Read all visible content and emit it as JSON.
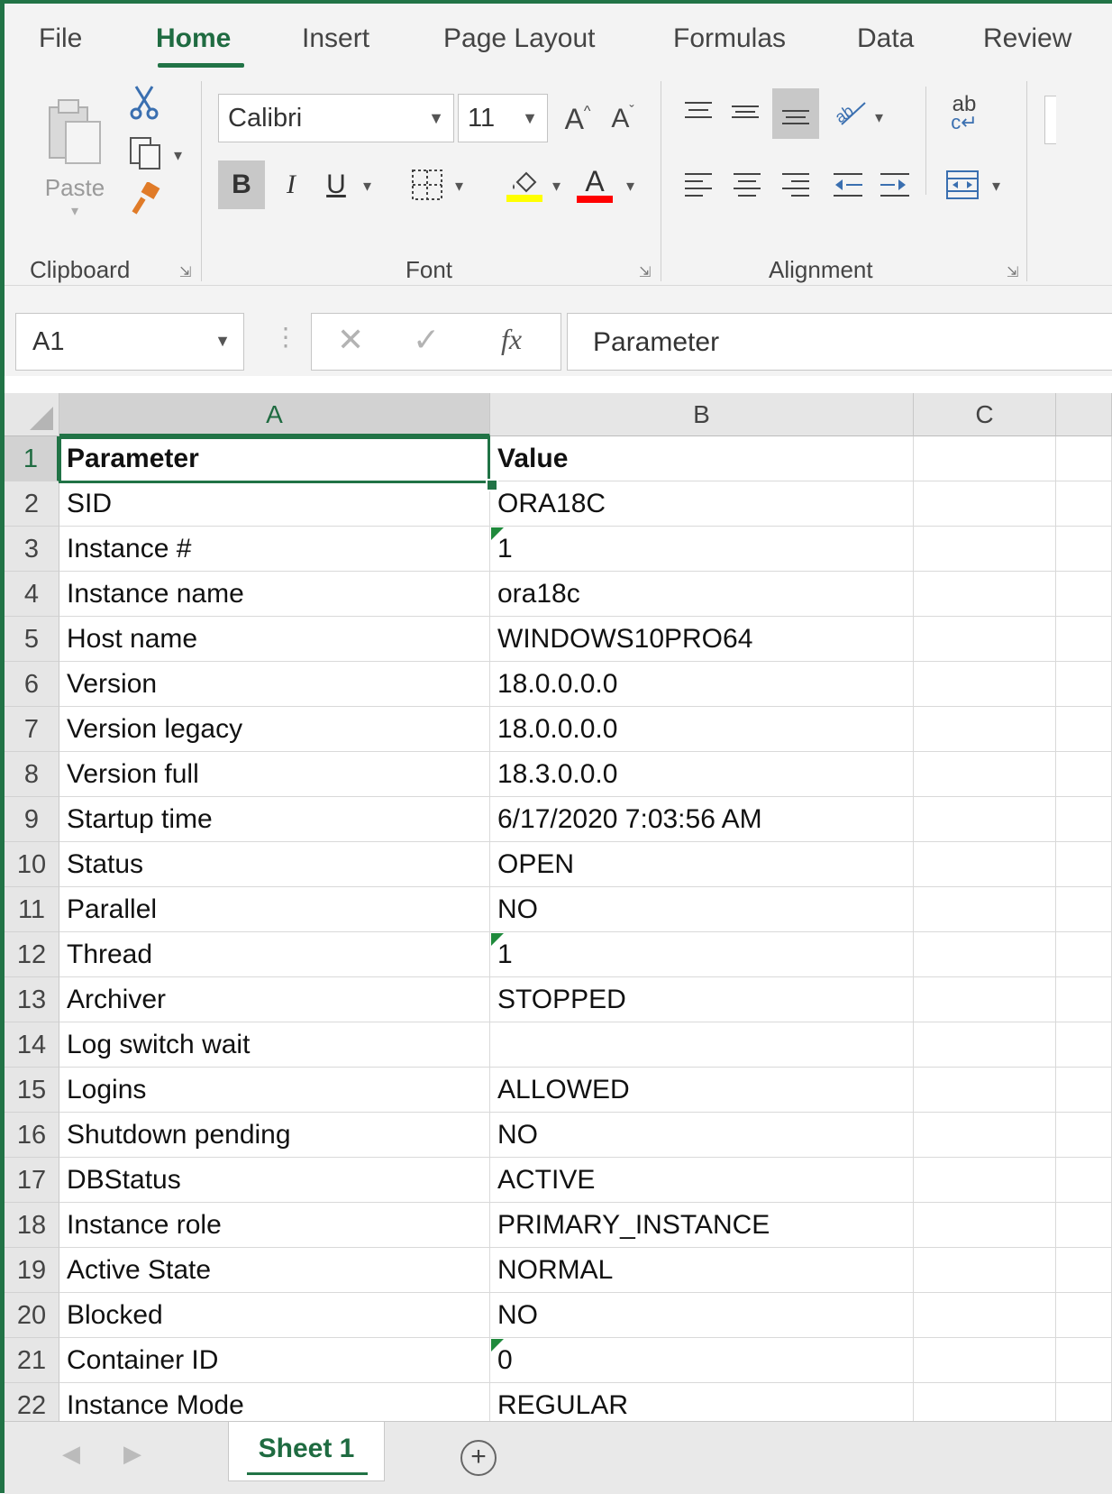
{
  "ribbon_tabs": [
    "File",
    "Home",
    "Insert",
    "Page Layout",
    "Formulas",
    "Data",
    "Review"
  ],
  "active_tab": "Home",
  "clipboard": {
    "paste_label": "Paste",
    "group_label": "Clipboard"
  },
  "font": {
    "family": "Calibri",
    "size": "11",
    "group_label": "Font",
    "grow_label": "A",
    "shrink_label": "A",
    "bold": "B",
    "italic": "I",
    "underline": "U",
    "font_color_label": "A"
  },
  "alignment": {
    "group_label": "Alignment",
    "wrap_label": "ab"
  },
  "colors": {
    "accent": "#217346",
    "highlight": "#ffff00",
    "font_color": "#ff0000"
  },
  "formula_bar": {
    "name_box": "A1",
    "fx": "fx",
    "cancel": "✕",
    "enter": "✓",
    "content": "Parameter"
  },
  "grid": {
    "columns": [
      "A",
      "B",
      "C"
    ],
    "rows": [
      {
        "num": "1",
        "a": "Parameter",
        "b": "Value"
      },
      {
        "num": "2",
        "a": "SID",
        "b": "ORA18C"
      },
      {
        "num": "3",
        "a": "Instance #",
        "b": "1"
      },
      {
        "num": "4",
        "a": "Instance name",
        "b": "ora18c"
      },
      {
        "num": "5",
        "a": "Host name",
        "b": "WINDOWS10PRO64"
      },
      {
        "num": "6",
        "a": "Version",
        "b": "18.0.0.0.0"
      },
      {
        "num": "7",
        "a": "Version legacy",
        "b": "18.0.0.0.0"
      },
      {
        "num": "8",
        "a": "Version full",
        "b": "18.3.0.0.0"
      },
      {
        "num": "9",
        "a": "Startup time",
        "b": "6/17/2020 7:03:56 AM"
      },
      {
        "num": "10",
        "a": "Status",
        "b": "OPEN"
      },
      {
        "num": "11",
        "a": "Parallel",
        "b": "NO"
      },
      {
        "num": "12",
        "a": "Thread",
        "b": "1"
      },
      {
        "num": "13",
        "a": "Archiver",
        "b": "STOPPED"
      },
      {
        "num": "14",
        "a": "Log switch wait",
        "b": ""
      },
      {
        "num": "15",
        "a": "Logins",
        "b": "ALLOWED"
      },
      {
        "num": "16",
        "a": "Shutdown pending",
        "b": "NO"
      },
      {
        "num": "17",
        "a": "DBStatus",
        "b": "ACTIVE"
      },
      {
        "num": "18",
        "a": "Instance role",
        "b": "PRIMARY_INSTANCE"
      },
      {
        "num": "19",
        "a": "Active State",
        "b": "NORMAL"
      },
      {
        "num": "20",
        "a": "Blocked",
        "b": "NO"
      },
      {
        "num": "21",
        "a": "Container ID",
        "b": "0"
      },
      {
        "num": "22",
        "a": "Instance Mode",
        "b": "REGULAR"
      }
    ]
  },
  "sheet_tabs": [
    "Sheet 1"
  ],
  "add_sheet": "+"
}
